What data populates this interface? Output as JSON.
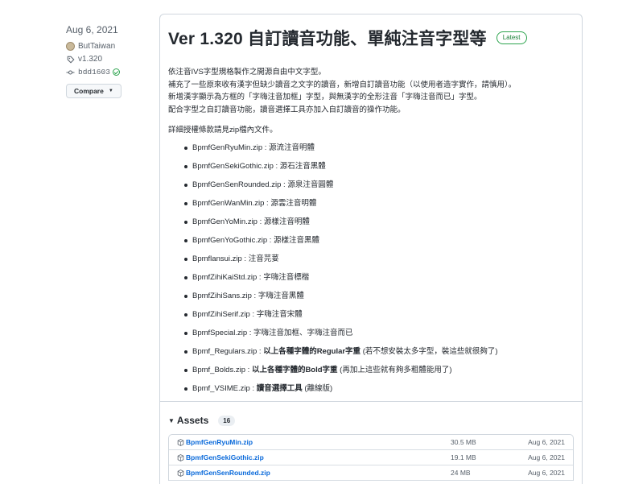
{
  "sidebar": {
    "date": "Aug 6, 2021",
    "author": "ButTaiwan",
    "tag": "v1.320",
    "commit": "bdd1603",
    "compare_label": "Compare"
  },
  "release": {
    "title": "Ver 1.320 自訂讀音功能、單純注音字型等",
    "badge": "Latest",
    "description": [
      "依注音IVS字型規格製作之開源自由中文字型。",
      "補充了一些原來收有漢字但缺少讀音之文字的讀音，新增自訂讀音功能（以使用者造字實作，請慎用）。",
      "新增漢字顯示為方框的「字嗨注音加框」字型，與無漢字的全形注音「字嗨注音而已」字型。",
      "配合字型之自訂讀音功能，讀音選擇工具亦加入自訂讀音的操作功能。"
    ],
    "license_note": "詳細授權條款請見zip檔內文件。",
    "files": [
      {
        "name": "BpmfGenRyuMin.zip",
        "desc": "源流注音明體",
        "bold": "",
        "extra": ""
      },
      {
        "name": "BpmfGenSekiGothic.zip",
        "desc": "源石注音黑體",
        "bold": "",
        "extra": ""
      },
      {
        "name": "BpmfGenSenRounded.zip",
        "desc": "源泉注音圓體",
        "bold": "",
        "extra": ""
      },
      {
        "name": "BpmfGenWanMin.zip",
        "desc": "源雲注音明體",
        "bold": "",
        "extra": ""
      },
      {
        "name": "BpmfGenYoMin.zip",
        "desc": "源樣注音明體",
        "bold": "",
        "extra": ""
      },
      {
        "name": "BpmfGenYoGothic.zip",
        "desc": "源樣注音黑體",
        "bold": "",
        "extra": ""
      },
      {
        "name": "Bpmflansui.zip",
        "desc": "注音芫荽",
        "bold": "",
        "extra": ""
      },
      {
        "name": "BpmfZihiKaiStd.zip",
        "desc": "字嗨注音標楷",
        "bold": "",
        "extra": ""
      },
      {
        "name": "BpmfZihiSans.zip",
        "desc": "字嗨注音黑體",
        "bold": "",
        "extra": ""
      },
      {
        "name": "BpmfZihiSerif.zip",
        "desc": "字嗨注音宋體",
        "bold": "",
        "extra": ""
      },
      {
        "name": "BpmfSpecial.zip",
        "desc": "字嗨注音加框、字嗨注音而已",
        "bold": "",
        "extra": ""
      },
      {
        "name": "Bpmf_Regulars.zip",
        "desc": "",
        "bold": "以上各種字體的Regular字重",
        "extra": " (若不想安裝太多字型，裝這些就很夠了)"
      },
      {
        "name": "Bpmf_Bolds.zip",
        "desc": "",
        "bold": "以上各種字體的Bold字重",
        "extra": " (再加上這些就有夠多粗體能用了)"
      },
      {
        "name": "Bpmf_VSIME.zip",
        "desc": "",
        "bold": "讀音選擇工具",
        "extra": " (離線版)"
      }
    ]
  },
  "assets": {
    "label": "Assets",
    "count": "16",
    "rows": [
      {
        "name": "BpmfGenRyuMin.zip",
        "size": "30.5 MB",
        "date": "Aug 6, 2021"
      },
      {
        "name": "BpmfGenSekiGothic.zip",
        "size": "19.1 MB",
        "date": "Aug 6, 2021"
      },
      {
        "name": "BpmfGenSenRounded.zip",
        "size": "24 MB",
        "date": "Aug 6, 2021"
      }
    ]
  },
  "icons": {
    "tag": "tag-icon",
    "commit": "commit-icon",
    "package": "package-icon",
    "verified": "verified-check-icon"
  },
  "colors": {
    "link": "#0969da",
    "latest_green": "#1a7f37",
    "border": "#d0d7de"
  }
}
